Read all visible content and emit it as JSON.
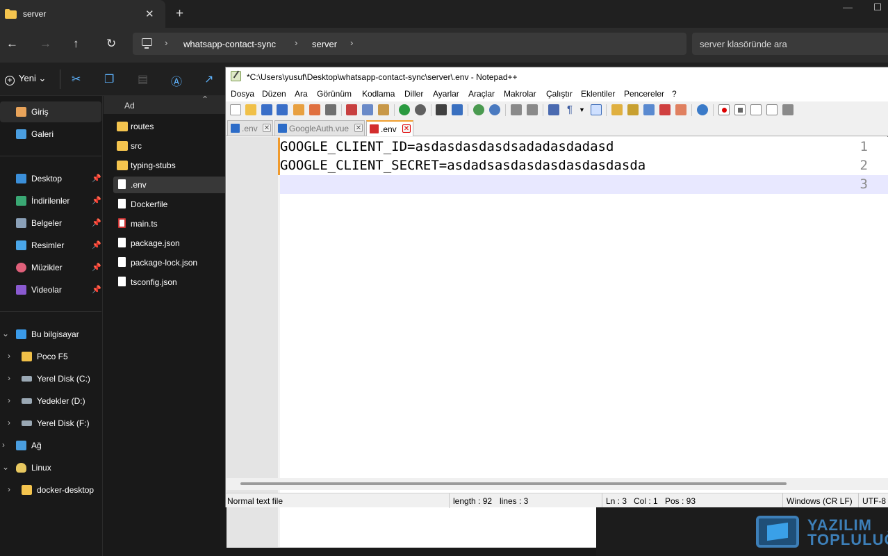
{
  "explorer": {
    "tab": {
      "title": "server"
    },
    "breadcrumb": [
      "whatsapp-contact-sync",
      "server"
    ],
    "search_placeholder": "server klasöründe ara",
    "command_bar": {
      "new_label": "Yeni"
    },
    "sidebar": {
      "top_items": [
        {
          "label": "Giriş",
          "icon": "home-icon",
          "selected": true
        },
        {
          "label": "Galeri",
          "icon": "gallery-icon"
        }
      ],
      "quick_access": [
        {
          "label": "Desktop",
          "icon": "desktop-icon",
          "pinned": true
        },
        {
          "label": "İndirilenler",
          "icon": "download-icon",
          "pinned": true
        },
        {
          "label": "Belgeler",
          "icon": "documents-icon",
          "pinned": true
        },
        {
          "label": "Resimler",
          "icon": "pictures-icon",
          "pinned": true
        },
        {
          "label": "Müzikler",
          "icon": "music-icon",
          "pinned": true
        },
        {
          "label": "Videolar",
          "icon": "videos-icon",
          "pinned": true
        }
      ],
      "tree": [
        {
          "label": "Bu bilgisayar",
          "icon": "computer-icon",
          "expanded": true,
          "level": 0
        },
        {
          "label": "Poco F5",
          "icon": "phone-icon",
          "level": 1
        },
        {
          "label": "Yerel Disk (C:)",
          "icon": "drive-icon",
          "level": 1
        },
        {
          "label": "Yedekler (D:)",
          "icon": "drive-icon",
          "level": 1
        },
        {
          "label": "Yerel Disk (F:)",
          "icon": "drive-icon",
          "level": 1
        },
        {
          "label": "Ağ",
          "icon": "network-icon",
          "level": 0
        },
        {
          "label": "Linux",
          "icon": "linux-icon",
          "expanded": true,
          "level": 0
        },
        {
          "label": "docker-desktop",
          "icon": "folder-icon",
          "level": 1
        }
      ]
    },
    "file_list": {
      "column_name": "Ad",
      "files": [
        {
          "name": "routes",
          "type": "folder"
        },
        {
          "name": "src",
          "type": "folder"
        },
        {
          "name": "typing-stubs",
          "type": "folder"
        },
        {
          "name": ".env",
          "type": "file",
          "selected": true
        },
        {
          "name": "Dockerfile",
          "type": "file"
        },
        {
          "name": "main.ts",
          "type": "ts"
        },
        {
          "name": "package.json",
          "type": "file"
        },
        {
          "name": "package-lock.json",
          "type": "file"
        },
        {
          "name": "tsconfig.json",
          "type": "file"
        }
      ]
    }
  },
  "notepad": {
    "title": "*C:\\Users\\yusuf\\Desktop\\whatsapp-contact-sync\\server\\.env - Notepad++",
    "menu": [
      "Dosya",
      "Düzen",
      "Ara",
      "Görünüm",
      "Kodlama",
      "Diller",
      "Ayarlar",
      "Araçlar",
      "Makrolar",
      "Çalıştır",
      "Eklentiler",
      "Pencereler",
      "?"
    ],
    "tabs": [
      {
        "label": ".env",
        "active": false,
        "modified": false
      },
      {
        "label": "GoogleAuth.vue",
        "active": false,
        "modified": false
      },
      {
        "label": ".env",
        "active": true,
        "modified": true
      }
    ],
    "line_numbers": [
      "1",
      "2",
      "3"
    ],
    "lines": [
      "GOOGLE_CLIENT_ID=asdasdasdasdsadadasdadasd",
      "GOOGLE_CLIENT_SECRET=asdadsasdasdasdasdasdasda",
      ""
    ],
    "status": {
      "file_type": "Normal text file",
      "length": "length : 92",
      "lines": "lines : 3",
      "ln": "Ln : 3",
      "col": "Col : 1",
      "pos": "Pos : 93",
      "eol": "Windows (CR LF)",
      "encoding": "UTF-8"
    }
  },
  "watermark": {
    "line1": "YAZILIM",
    "line2": "TOPLULUĞU"
  },
  "colors": {
    "accent_orange": "#f0a030",
    "folder_yellow": "#f4c44e",
    "current_line": "#e8e8ff"
  }
}
